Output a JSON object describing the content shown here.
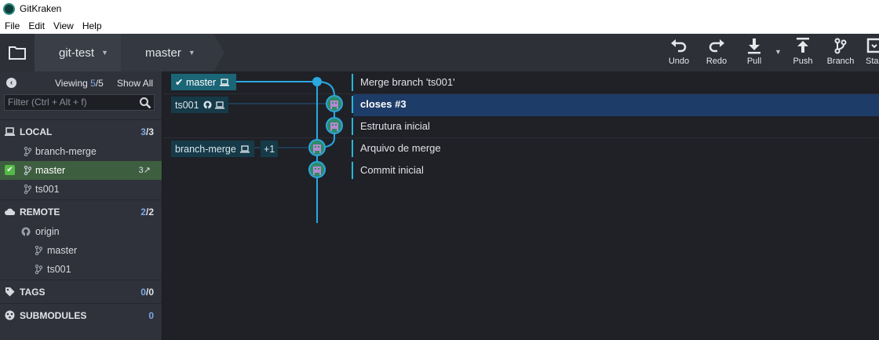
{
  "window": {
    "title": "GitKraken"
  },
  "menu": [
    "File",
    "Edit",
    "View",
    "Help"
  ],
  "toolbar": {
    "repo": "git-test",
    "branch": "master",
    "actions": {
      "undo": "Undo",
      "redo": "Redo",
      "pull": "Pull",
      "push": "Push",
      "branch": "Branch",
      "stash": "Sta"
    }
  },
  "left_panel": {
    "viewing_label": "Viewing",
    "viewing_shown": "5",
    "viewing_total": "/5",
    "show_all": "Show All",
    "filter_placeholder": "Filter (Ctrl + Alt + f)",
    "local": {
      "title": "LOCAL",
      "count_a": "3",
      "count_b": "/3",
      "items": [
        {
          "label": "branch-merge"
        },
        {
          "label": "master",
          "ahead": "3↗"
        },
        {
          "label": "ts001"
        }
      ]
    },
    "remote": {
      "title": "REMOTE",
      "count_a": "2",
      "count_b": "/2",
      "origin": "origin",
      "items": [
        {
          "label": "master"
        },
        {
          "label": "ts001"
        }
      ]
    },
    "tags": {
      "title": "TAGS",
      "count_a": "0",
      "count_b": "/0"
    },
    "submodules": {
      "title": "SUBMODULES",
      "count": "0"
    }
  },
  "graph": {
    "refs": {
      "master": "master",
      "ts001": "ts001",
      "branch_merge": "branch-merge",
      "extra": "+1"
    },
    "commits": [
      {
        "message": "Merge branch 'ts001'"
      },
      {
        "message": "closes #3"
      },
      {
        "message": "Estrutura inicial"
      },
      {
        "message": "Arquivo de merge"
      },
      {
        "message": "Commit inicial"
      }
    ]
  }
}
